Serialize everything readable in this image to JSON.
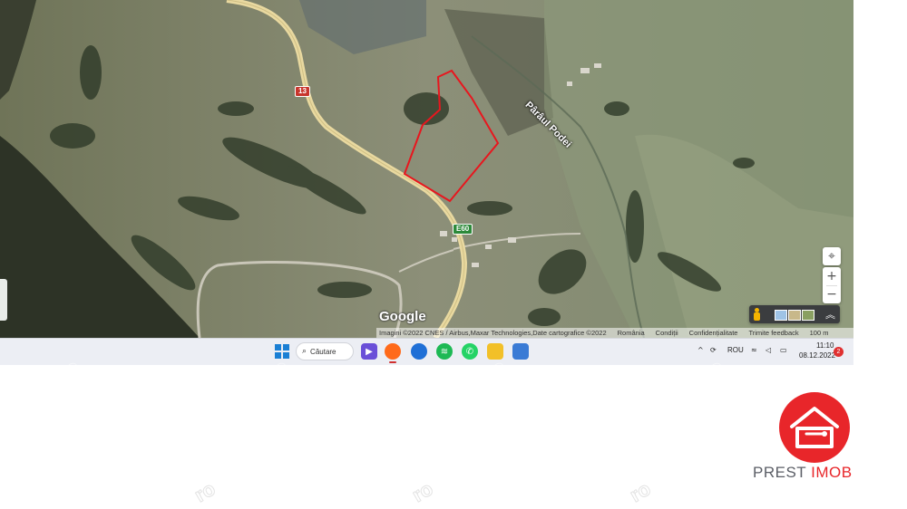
{
  "map": {
    "road_labels": {
      "road_13": "13",
      "road_e60": "E60",
      "stream_name": "Pârâul Podei"
    },
    "logo": "Google",
    "attribution": {
      "imagery": "Imagini ©2022 CNES / Airbus,Maxar Technologies,Date cartografice ©2022",
      "country": "România",
      "terms": "Condiții",
      "privacy": "Confidențialitate",
      "feedback": "Trimite feedback",
      "scale": "100 m"
    },
    "controls": {
      "zoom_in": "+",
      "zoom_out": "−",
      "locate_icon": "crosshair-icon",
      "pegman_icon": "pegman-icon",
      "expand_icon": "chevron-up-icon"
    },
    "plot_outline_color": "#e8161e"
  },
  "taskbar": {
    "search_label": "Căutare",
    "tray": {
      "expand": "^",
      "language": "ROU",
      "time": "11:10",
      "date": "08.12.2022",
      "notification_count": "2"
    }
  },
  "brand": {
    "name_part1": "PREST",
    "name_part2": "IMOB",
    "color": "#e8262a"
  },
  "watermark": "ro"
}
